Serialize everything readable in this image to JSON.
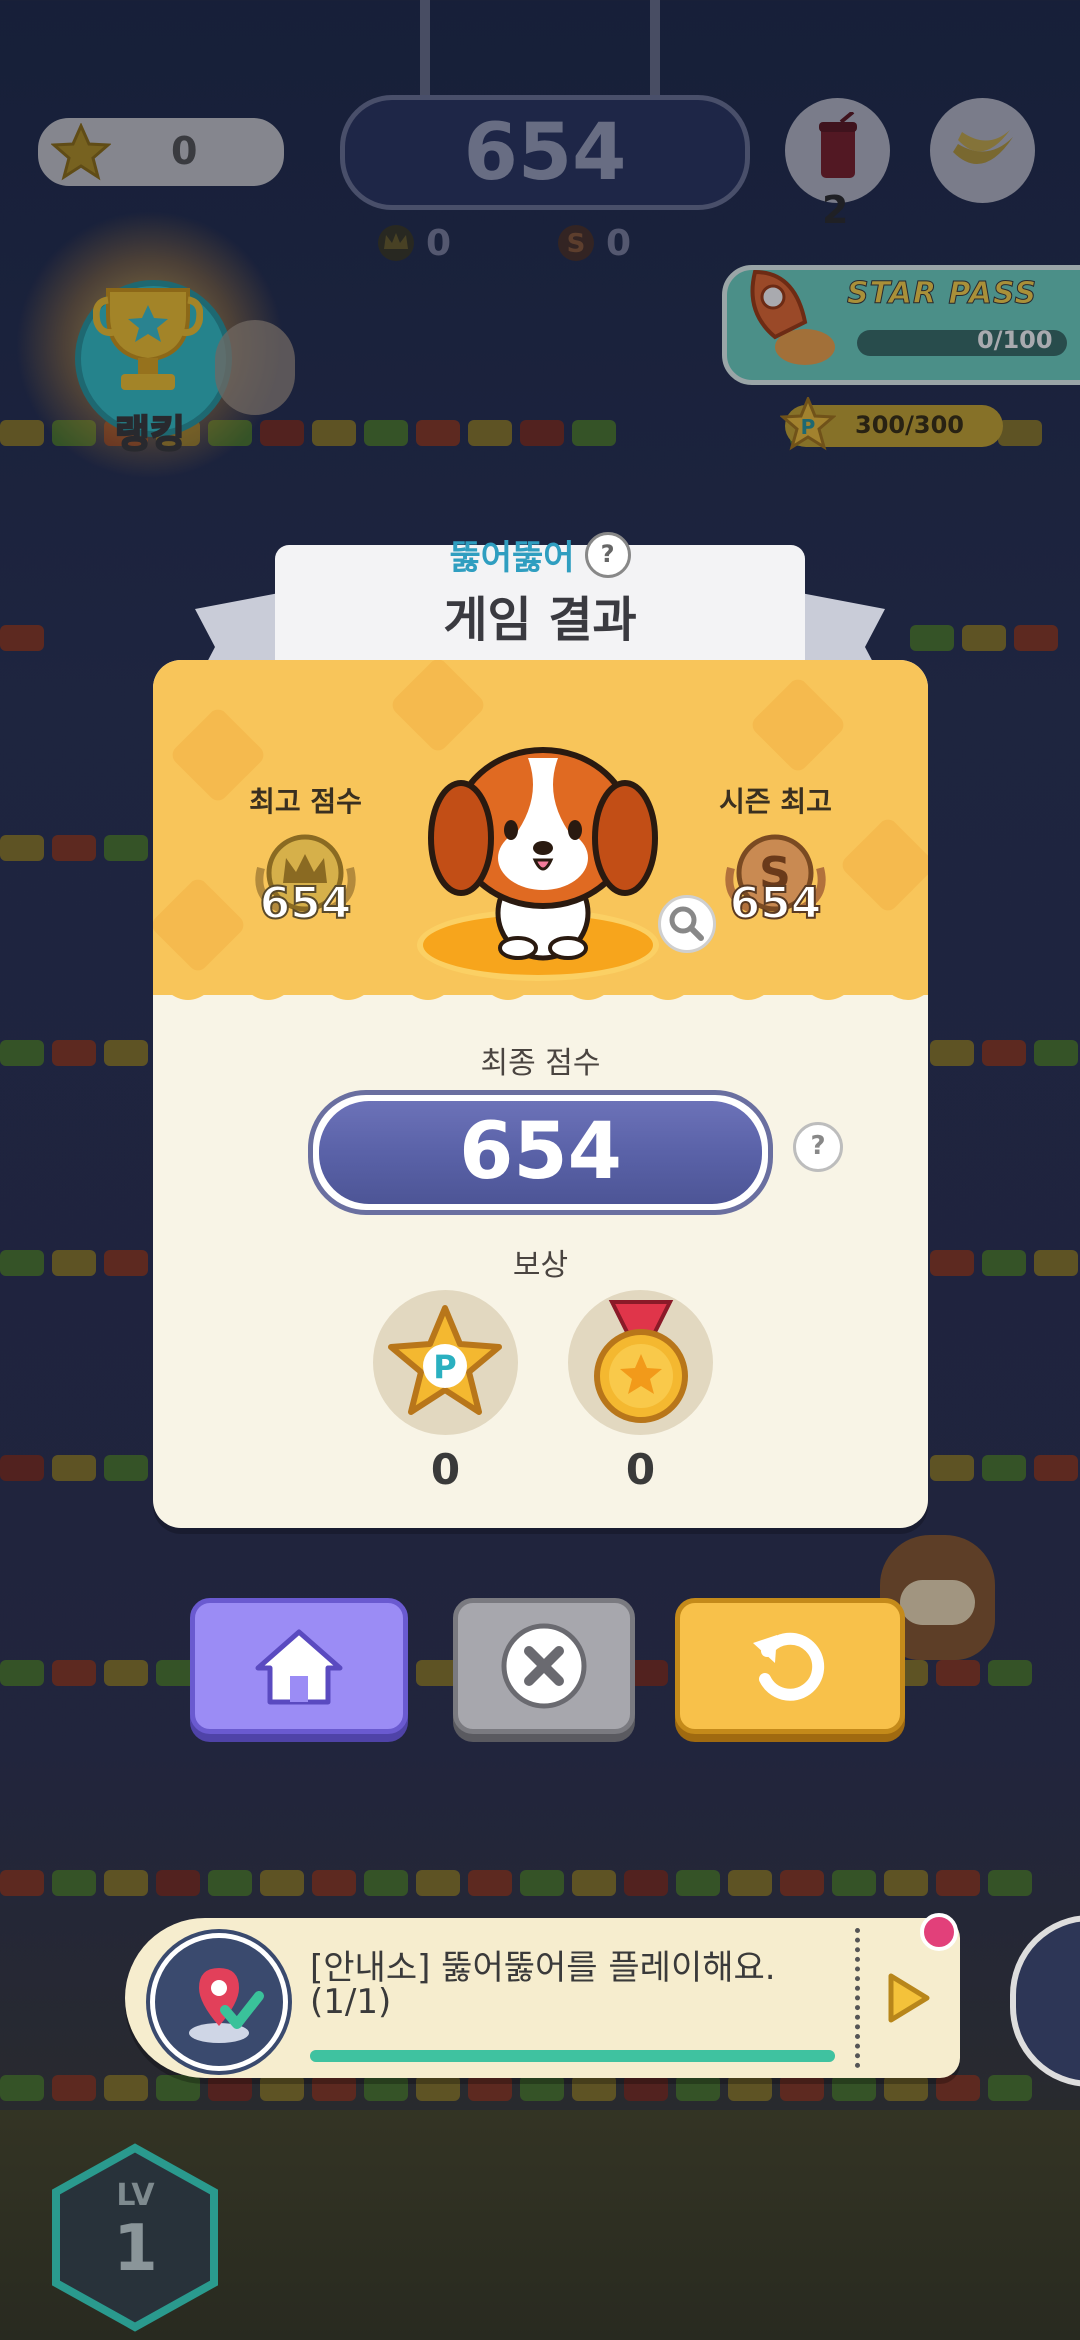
{
  "hud": {
    "stars": "0",
    "score": "654",
    "drink_count": "2",
    "crown_count": "0",
    "season_count": "0",
    "ranking_label": "랭킹"
  },
  "starpass": {
    "title": "STAR PASS",
    "progress_text": "0/100",
    "progress": 0,
    "points_text": "300/300",
    "points_icon_letter": "P"
  },
  "result": {
    "subtitle": "뚫어뚫어",
    "help_glyph": "?",
    "title": "게임 결과",
    "best_label": "최고 점수",
    "best_value": "654",
    "season_label": "시즌 최고",
    "season_value": "654",
    "season_icon_letter": "S",
    "final_label": "최종 점수",
    "final_value": "654",
    "reward_label": "보상",
    "reward_points": "0",
    "reward_coins": "0",
    "reward_points_letter": "P"
  },
  "quest": {
    "text_line1": "[안내소] 뚫어뚫어를 플레이해요.",
    "text_line2": "(1/1)",
    "progress": 1.0
  },
  "level": {
    "label": "LV",
    "value": "1"
  },
  "colors": {
    "panel_yellow": "#f8c55a",
    "home_button": "#9b8cf5",
    "close_button": "#a7a7ad",
    "retry_button": "#f8c14a",
    "score_bar": "#5a62a8",
    "quest_progress": "#3fc2a0"
  }
}
